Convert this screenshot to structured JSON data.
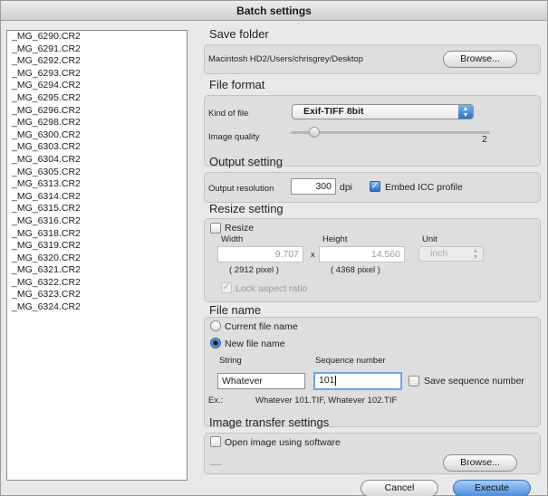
{
  "window": {
    "title": "Batch settings"
  },
  "file_list": {
    "items": [
      "_MG_6290.CR2",
      "_MG_6291.CR2",
      "_MG_6292.CR2",
      "_MG_6293.CR2",
      "_MG_6294.CR2",
      "_MG_6295.CR2",
      "_MG_6296.CR2",
      "_MG_6298.CR2",
      "_MG_6300.CR2",
      "_MG_6303.CR2",
      "_MG_6304.CR2",
      "_MG_6305.CR2",
      "_MG_6313.CR2",
      "_MG_6314.CR2",
      "_MG_6315.CR2",
      "_MG_6316.CR2",
      "_MG_6318.CR2",
      "_MG_6319.CR2",
      "_MG_6320.CR2",
      "_MG_6321.CR2",
      "_MG_6322.CR2",
      "_MG_6323.CR2",
      "_MG_6324.CR2"
    ]
  },
  "save_folder": {
    "title": "Save folder",
    "path": "Macintosh HD2/Users/chrisgrey/Desktop",
    "browse_label": "Browse..."
  },
  "file_format": {
    "title": "File format",
    "kind_label": "Kind of file",
    "kind_value": "Exif-TIFF 8bit",
    "quality_label": "Image quality",
    "quality_value": "2",
    "quality_level": 0.12
  },
  "output_setting": {
    "title": "Output setting",
    "resolution_label": "Output resolution",
    "resolution_value": "300",
    "resolution_unit": "dpi",
    "embed_icc_label": "Embed ICC profile",
    "embed_icc_checked": true
  },
  "resize_setting": {
    "title": "Resize setting",
    "resize_label": "Resize",
    "resize_checked": false,
    "width_label": "Width",
    "width_value": "9.707",
    "width_pixels": "( 2912 pixel )",
    "times": "x",
    "height_label": "Height",
    "height_value": "14.560",
    "height_pixels": "( 4368 pixel )",
    "unit_label": "Unit",
    "unit_value": "inch",
    "lock_label": "Lock aspect ratio"
  },
  "file_name": {
    "title": "File name",
    "current_label": "Current file name",
    "new_label": "New file name",
    "string_label": "String",
    "string_value": "Whatever",
    "sequence_label": "Sequence number",
    "sequence_value": "101",
    "save_seq_label": "Save sequence number",
    "example_label": "Ex.:",
    "example_value": "Whatever 101.TIF, Whatever 102.TIF"
  },
  "image_transfer": {
    "title": "Image transfer settings",
    "open_label": "Open image using software",
    "software_value": "----",
    "browse_label": "Browse..."
  },
  "footer": {
    "cancel_label": "Cancel",
    "execute_label": "Execute"
  }
}
